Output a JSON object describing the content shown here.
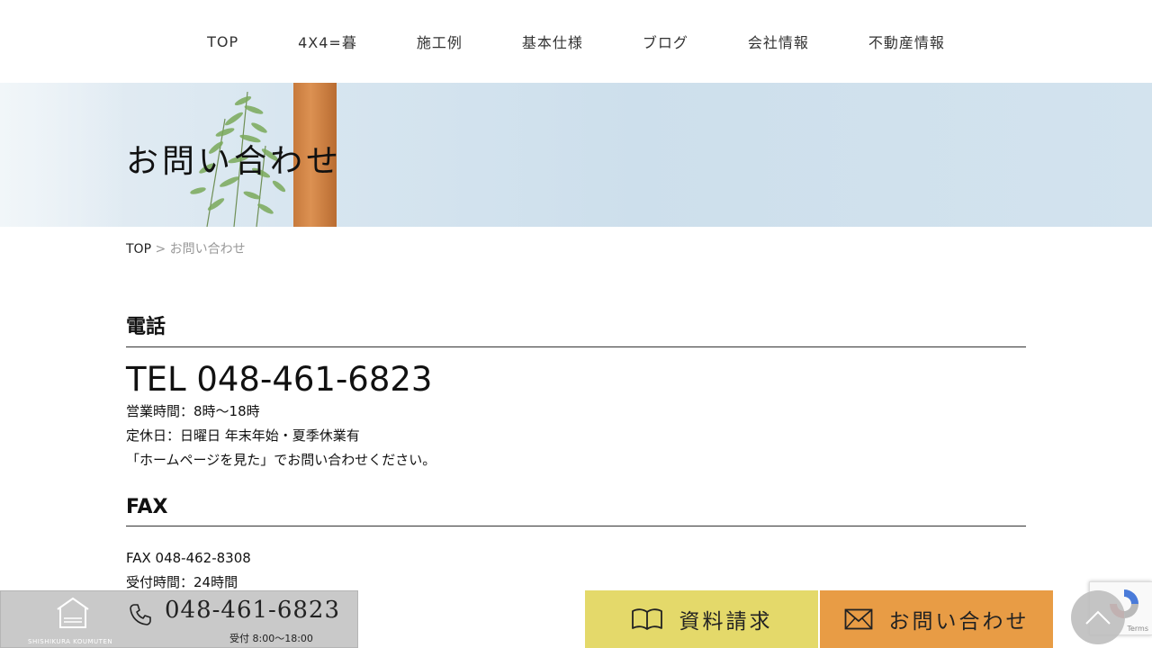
{
  "nav": {
    "items": [
      "TOP",
      "4X4=暮",
      "施工例",
      "基本仕様",
      "ブログ",
      "会社情報",
      "不動産情報"
    ]
  },
  "hero": {
    "title": "お問い合わせ"
  },
  "breadcrumb": {
    "home": "TOP",
    "separator": " > ",
    "current": "お問い合わせ"
  },
  "phone_section": {
    "heading": "電話",
    "tel": "TEL 048-461-6823",
    "lines": [
      "営業時間：8時～18時",
      "定休日：日曜日 年末年始・夏季休業有",
      "「ホームページを見た」でお問い合わせください。"
    ]
  },
  "fax_section": {
    "heading": "FAX",
    "lines": [
      "FAX 048-462-8308",
      "受付時間：24時間"
    ]
  },
  "bottom_bar": {
    "logo_text": "SHISHIKURA KOUMUTEN",
    "tel": "048-461-6823",
    "hours": "受付 8:00〜18:00",
    "doc_request_label": "資料請求",
    "contact_label": "お問い合わせ",
    "colors": {
      "doc_request_bg": "#e4d96a",
      "contact_bg": "#e89c45",
      "tel_bg": "#c9c9c9"
    }
  },
  "recaptcha": {
    "terms": "Terms"
  }
}
